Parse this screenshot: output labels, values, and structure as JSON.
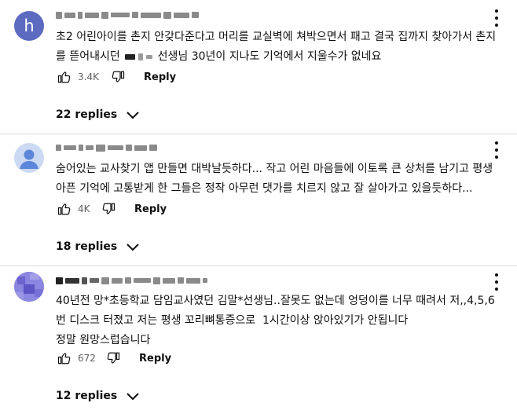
{
  "comments": [
    {
      "avatar_letter": "h",
      "text_part1": "초2 어린아이를 촌지 안갖다준다고 머리를 교실벽에 쳐박으면서 패고 결국 집까지 찾아가서 촌지를 뜯어내시던",
      "text_part2": "선생님 30년이 지나도 기억에서 지울수가 없네요",
      "likes": "3.4K",
      "reply_label": "Reply",
      "replies_label": "22 replies"
    },
    {
      "text": "숨어있는 교사찾기 앱 만들면 대박날듯하다... 작고 어린 마음들에 이토록 큰 상처를 남기고 평생 아픈 기억에 고통받게 한 그들은 정작 아무런 댓가를 치르지 않고 잘 살아가고 있을듯하다...",
      "likes": "4K",
      "reply_label": "Reply",
      "replies_label": "18 replies"
    },
    {
      "text_line1": "40년전 망*초등학교 담임교사였던 김말*선생님..잘못도 없는데 엉덩이를 너무 때려서 저,,4,5,6번 디스크 터졌고 저는 평생 꼬리뼈통증으로  1시간이상 앉아있기가 안됩니다",
      "text_line2": "정말 원망스럽습니다",
      "likes": "672",
      "reply_label": "Reply",
      "replies_label": "12 replies"
    }
  ],
  "icons": {
    "like": "thumbs-up-icon",
    "dislike": "thumbs-down-icon",
    "menu": "more-vert-icon",
    "expand": "chevron-down-icon",
    "avatar_default": "person-icon"
  },
  "colors": {
    "text": "#0f0f0f",
    "secondary": "#606060",
    "avatar_h": "#5c6bc0",
    "avatar_default": "#ccd9f3",
    "divider": "#d9d9d9"
  }
}
